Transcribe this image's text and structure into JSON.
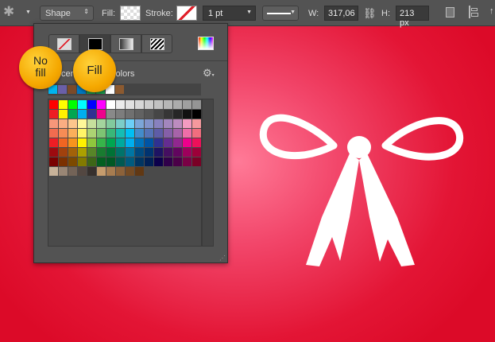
{
  "toolbar": {
    "tool_icon": "custom-shape-tool-icon",
    "mode": "Shape",
    "fill_label": "Fill:",
    "stroke_label": "Stroke:",
    "stroke_width": "1 pt",
    "w_label": "W:",
    "w_value": "317,06 p",
    "h_label": "H:",
    "h_value": "213 px",
    "link_icon": "link-icon"
  },
  "panel": {
    "modes": [
      "No Color",
      "Solid Color",
      "Gradient",
      "Pattern"
    ],
    "section_label": "Recently Used Colors",
    "recent": [
      "#00b4ef",
      "#6a5fa8",
      "#7a4a2a",
      "#0078c0",
      "#1aa050",
      "#1aa050",
      "#ffffff",
      "#8c5a30"
    ],
    "swatches": [
      [
        "#ff0000",
        "#ffff00",
        "#00ff00",
        "#00ffff",
        "#0000ff",
        "#ff00ff",
        "#ffffff",
        "#ebebeb",
        "#e1e1e1",
        "#d7d7d7",
        "#cccccc",
        "#c2c2c2",
        "#b7b7b7",
        "#acacac",
        "#a0a0a0",
        "#959595"
      ],
      [
        "#ee1d24",
        "#fff100",
        "#00a650",
        "#00aeef",
        "#2f3192",
        "#ed008c",
        "#898989",
        "#7d7d7d",
        "#707070",
        "#626262",
        "#555555",
        "#464646",
        "#363636",
        "#262626",
        "#111111",
        "#000000"
      ],
      [
        "#f7977a",
        "#fbad82",
        "#fdc68c",
        "#fff799",
        "#c6df9c",
        "#a4d49d",
        "#81ca9d",
        "#7bcdc9",
        "#6ccff7",
        "#7ca6d8",
        "#8293ca",
        "#8881be",
        "#a286bd",
        "#bc8cbf",
        "#f49bc1",
        "#f5999d"
      ],
      [
        "#f26c4f",
        "#f68c55",
        "#fbaf5a",
        "#fff467",
        "#acd372",
        "#7dc473",
        "#39b778",
        "#16bcb4",
        "#00bff3",
        "#438ccb",
        "#5573b7",
        "#5e5ca7",
        "#855fa8",
        "#a763a9",
        "#ef6ea8",
        "#f16d7e"
      ],
      [
        "#ee1d24",
        "#f16522",
        "#f7941d",
        "#fff100",
        "#8fc63d",
        "#37b44a",
        "#00a650",
        "#00a99e",
        "#00aeef",
        "#0072bc",
        "#0054a5",
        "#2f3192",
        "#652c91",
        "#91278f",
        "#ed008c",
        "#ee105a"
      ],
      [
        "#9d0a0f",
        "#a1410d",
        "#a36209",
        "#aba000",
        "#588528",
        "#197b30",
        "#007236",
        "#00736a",
        "#0076a4",
        "#004a80",
        "#003370",
        "#1d1363",
        "#450e61",
        "#62055f",
        "#9e005c",
        "#9d0039"
      ],
      [
        "#790000",
        "#7b3000",
        "#7c4900",
        "#827a00",
        "#3e6617",
        "#045f20",
        "#005824",
        "#005951",
        "#005b7e",
        "#003562",
        "#002056",
        "#0c004b",
        "#30004a",
        "#4b0048",
        "#7a0045",
        "#7a0026"
      ],
      [
        "#c7b299",
        "#998675",
        "#736357",
        "#534741",
        "#37302d",
        "#c69c6d",
        "#a77c50",
        "#8c623a",
        "#744b24",
        "#613813"
      ]
    ]
  },
  "callouts": {
    "no_fill": "No fill",
    "fill": "Fill"
  }
}
